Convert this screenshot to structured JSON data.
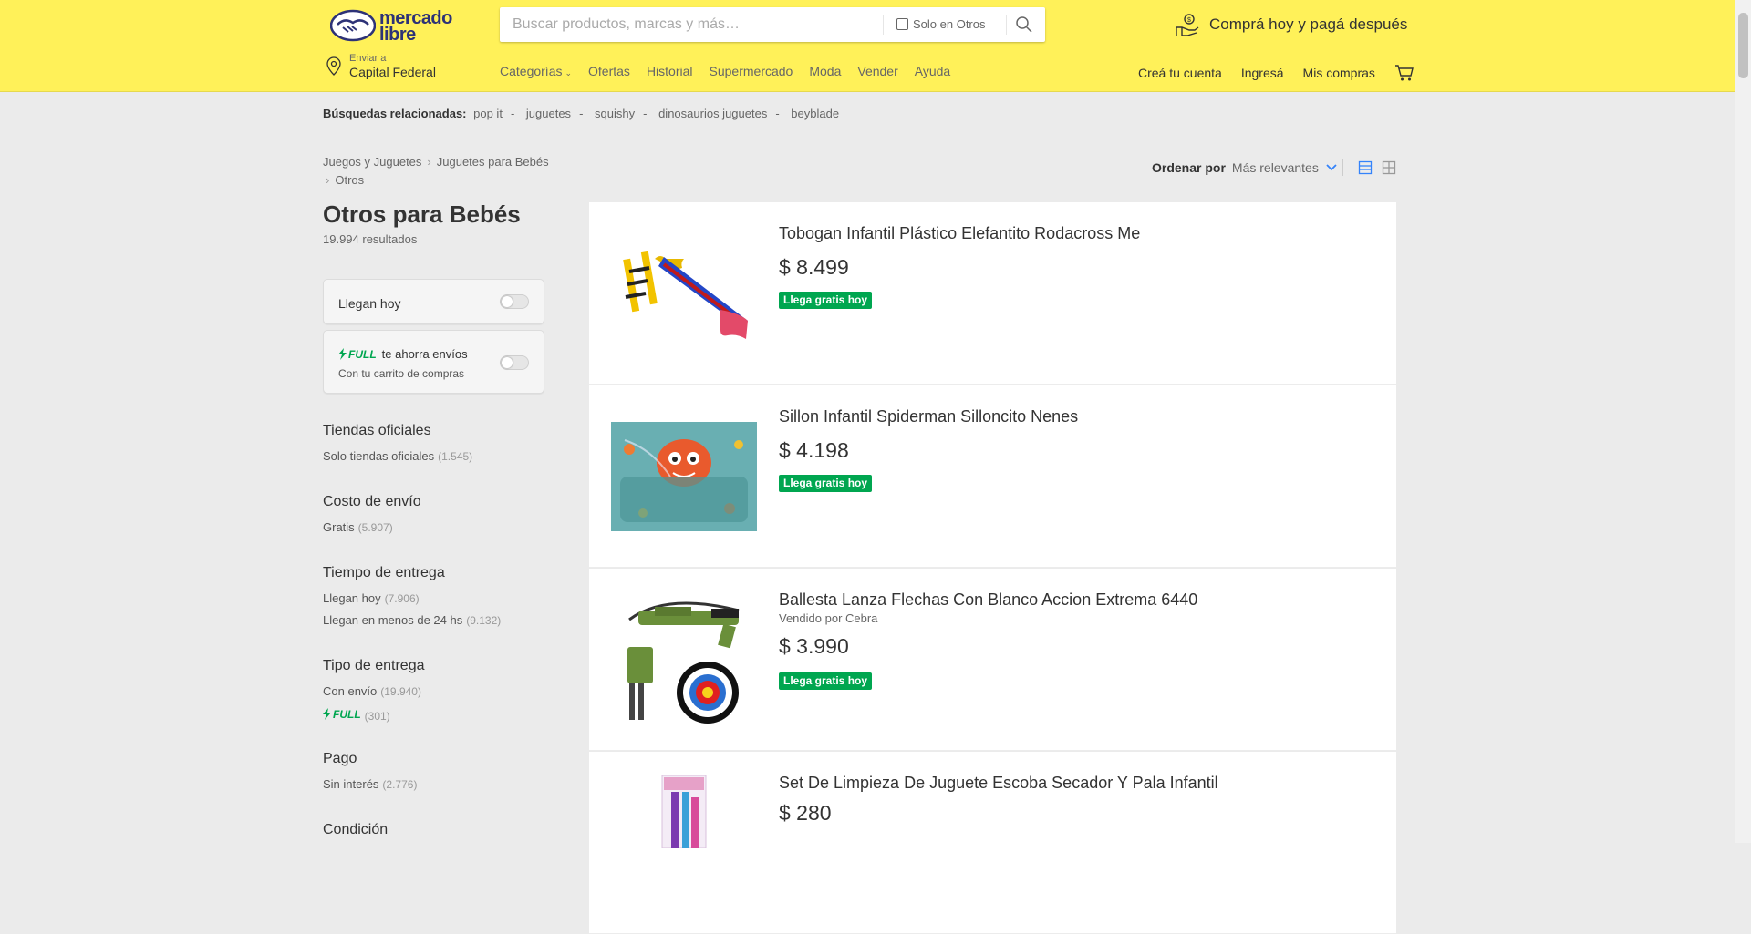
{
  "header": {
    "logo_text": "mercado libre",
    "search_placeholder": "Buscar productos, marcas y más…",
    "search_checkbox_label": "Solo en Otros",
    "promo_text": "Comprá hoy y pagá después",
    "ship_to_label": "Enviar a",
    "ship_to_location": "Capital Federal",
    "nav": [
      "Categorías",
      "Ofertas",
      "Historial",
      "Supermercado",
      "Moda",
      "Vender",
      "Ayuda"
    ],
    "account": [
      "Creá tu cuenta",
      "Ingresá",
      "Mis compras"
    ]
  },
  "related": {
    "label": "Búsquedas relacionadas:",
    "items": [
      "pop it",
      "juguetes",
      "squishy",
      "dinosaurios juguetes",
      "beyblade"
    ]
  },
  "breadcrumb": [
    "Juegos y Juguetes",
    "Juguetes para Bebés",
    "Otros"
  ],
  "sort": {
    "label": "Ordenar por",
    "value": "Más relevantes"
  },
  "sidebar": {
    "title": "Otros para Bebés",
    "results_count": "19.994 resultados",
    "toggle_today": "Llegan hoy",
    "full_badge": "FULL",
    "full_text": "te ahorra envíos",
    "full_sub": "Con tu carrito de compras",
    "sections": [
      {
        "title": "Tiendas oficiales",
        "options": [
          {
            "label": "Solo tiendas oficiales",
            "count": "(1.545)"
          }
        ]
      },
      {
        "title": "Costo de envío",
        "options": [
          {
            "label": "Gratis",
            "count": "(5.907)"
          }
        ]
      },
      {
        "title": "Tiempo de entrega",
        "options": [
          {
            "label": "Llegan hoy",
            "count": "(7.906)"
          },
          {
            "label": "Llegan en menos de 24 hs",
            "count": "(9.132)"
          }
        ]
      },
      {
        "title": "Tipo de entrega",
        "options": [
          {
            "label": "Con envío",
            "count": "(19.940)"
          },
          {
            "label": "FULL",
            "count": "(301)"
          }
        ]
      },
      {
        "title": "Pago",
        "options": [
          {
            "label": "Sin interés",
            "count": "(2.776)"
          }
        ]
      },
      {
        "title": "Condición",
        "options": []
      }
    ]
  },
  "results": [
    {
      "title": "Tobogan Infantil Plástico Elefantito Rodacross Me",
      "seller": "",
      "price": "$ 8.499",
      "badge": "Llega gratis hoy"
    },
    {
      "title": "Sillon Infantil Spiderman Silloncito Nenes",
      "seller": "",
      "price": "$ 4.198",
      "badge": "Llega gratis hoy"
    },
    {
      "title": "Ballesta Lanza Flechas Con Blanco Accion Extrema 6440",
      "seller": "Vendido por Cebra",
      "price": "$ 3.990",
      "badge": "Llega gratis hoy"
    },
    {
      "title": "Set De Limpieza De Juguete Escoba Secador Y Pala Infantil",
      "seller": "",
      "price": "$ 280",
      "badge": ""
    }
  ],
  "colors": {
    "header_bg": "#fff159",
    "brand_blue": "#2d3277",
    "free_green": "#00a650",
    "link_blue": "#3483fa"
  }
}
